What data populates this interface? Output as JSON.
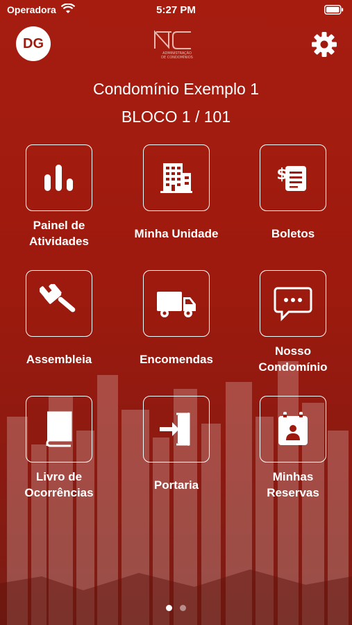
{
  "status": {
    "carrier": "Operadora",
    "time": "5:27 PM"
  },
  "header": {
    "avatar_initials": "DG",
    "logo_mark": "NC",
    "logo_line1": "ADMINISTRAÇÃO",
    "logo_line2": "DE CONDOMÍNIOS",
    "settings_icon": "gear-icon"
  },
  "condo": {
    "name": "Condomínio Exemplo 1",
    "unit": "BLOCO 1 / 101"
  },
  "menu": [
    {
      "label1": "Painel de",
      "label2": "Atividades",
      "icon": "bar-chart-icon"
    },
    {
      "label1": "Minha Unidade",
      "label2": "",
      "icon": "building-icon"
    },
    {
      "label1": "Boletos",
      "label2": "",
      "icon": "invoice-icon"
    },
    {
      "label1": "Assembleia",
      "label2": "",
      "icon": "gavel-icon"
    },
    {
      "label1": "Encomendas",
      "label2": "",
      "icon": "truck-icon"
    },
    {
      "label1": "Nosso",
      "label2": "Condomínio",
      "icon": "chat-bubble-icon"
    },
    {
      "label1": "Livro de",
      "label2": "Ocorrências",
      "icon": "book-icon"
    },
    {
      "label1": "Portaria",
      "label2": "",
      "icon": "door-enter-icon"
    },
    {
      "label1": "Minhas",
      "label2": "Reservas",
      "icon": "calendar-person-icon"
    }
  ],
  "pager": {
    "pages": 2,
    "active": 1
  },
  "colors": {
    "background": "#9e1a0e",
    "foreground": "#ffffff"
  }
}
